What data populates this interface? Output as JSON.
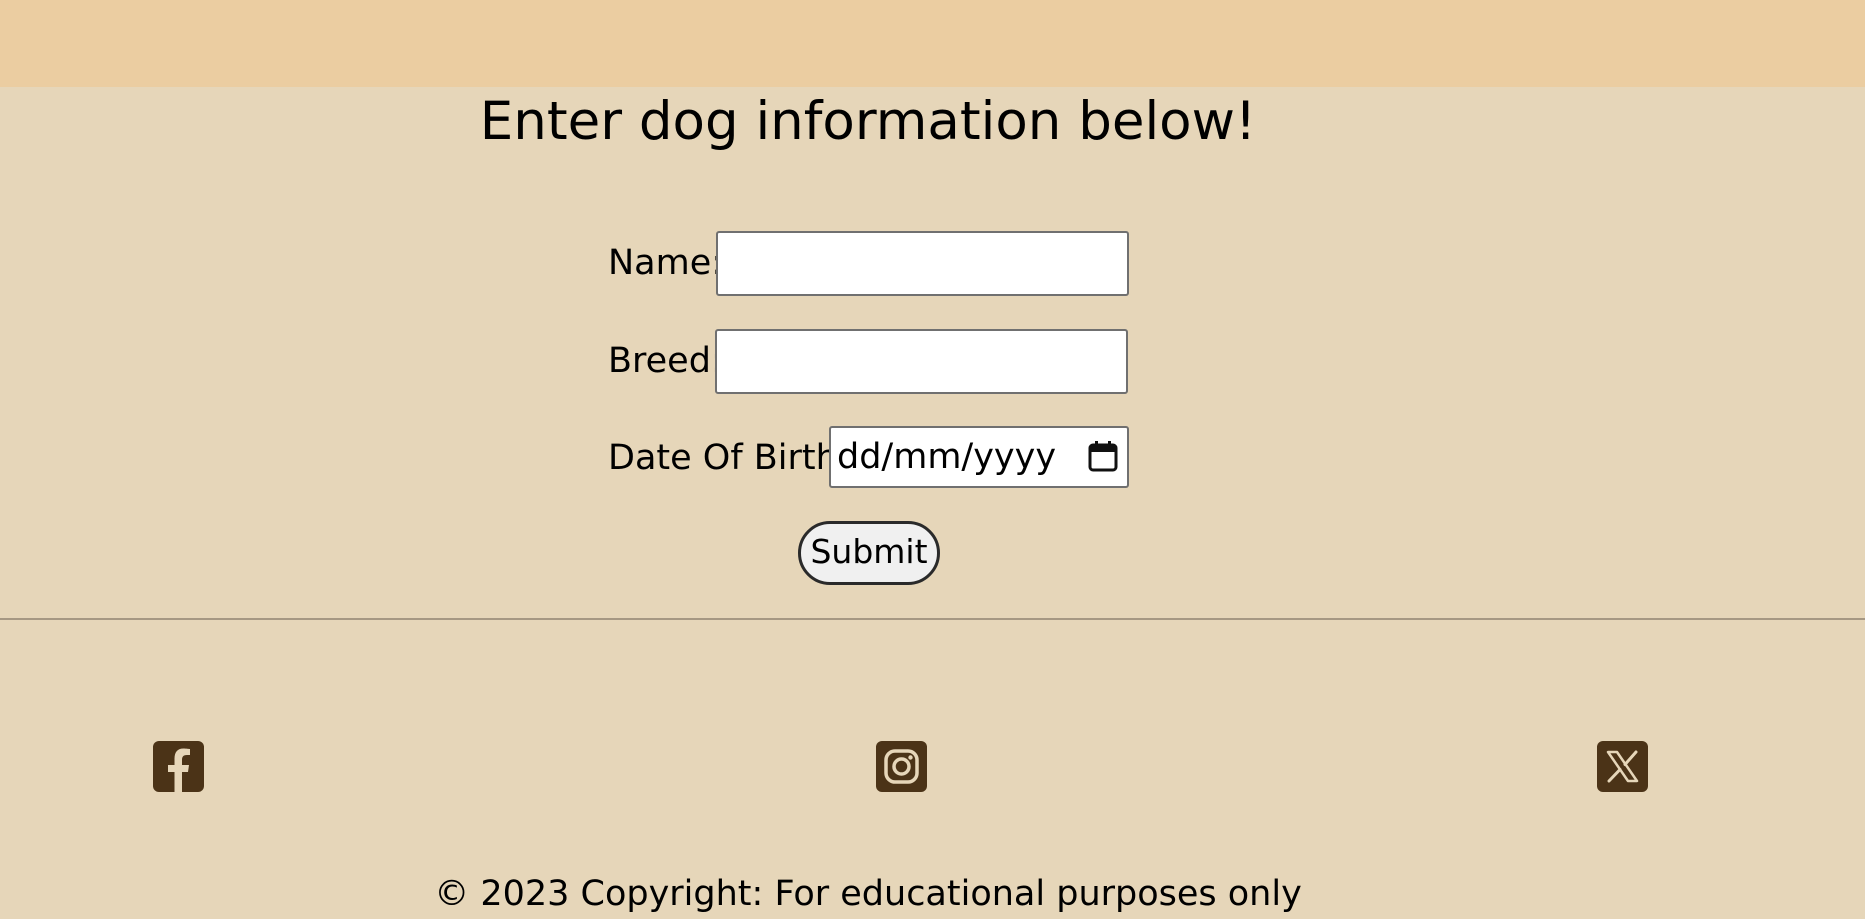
{
  "form": {
    "heading": "Enter dog information below!",
    "name_label": "Name:",
    "name_value": "",
    "breed_label": "Breed:",
    "breed_value": "",
    "dob_label": "Date Of Birth:",
    "dob_placeholder": "dd/mm/yyyy",
    "submit_label": "Submit"
  },
  "footer": {
    "social_icons": [
      "facebook-icon",
      "instagram-icon",
      "x-twitter-icon"
    ],
    "copyright": "© 2023 Copyright: For educational purposes only"
  },
  "colors": {
    "page_background": "#e6d6b9",
    "header_bar": "#ebcda1",
    "icon_brown": "#4b3317",
    "divider": "#a69883"
  }
}
